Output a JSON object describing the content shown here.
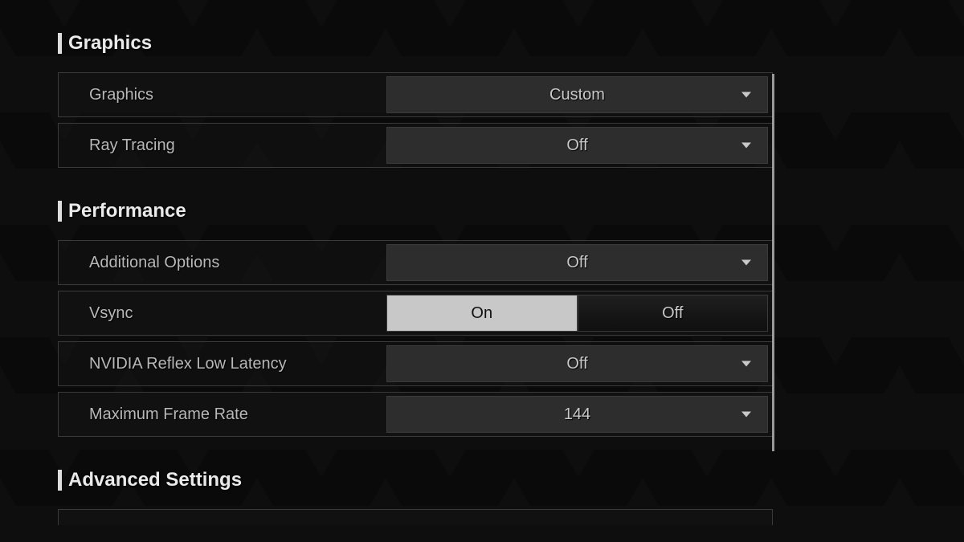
{
  "sections": {
    "graphics": {
      "title": "Graphics",
      "rows": {
        "graphics_preset": {
          "label": "Graphics",
          "value": "Custom"
        },
        "ray_tracing": {
          "label": "Ray Tracing",
          "value": "Off"
        }
      }
    },
    "performance": {
      "title": "Performance",
      "rows": {
        "additional_options": {
          "label": "Additional Options",
          "value": "Off"
        },
        "vsync": {
          "label": "Vsync",
          "on": "On",
          "off": "Off",
          "selected": "On"
        },
        "reflex": {
          "label": "NVIDIA Reflex Low Latency",
          "value": "Off"
        },
        "max_fps": {
          "label": "Maximum Frame Rate",
          "value": "144"
        }
      }
    },
    "advanced": {
      "title": "Advanced Settings"
    }
  }
}
